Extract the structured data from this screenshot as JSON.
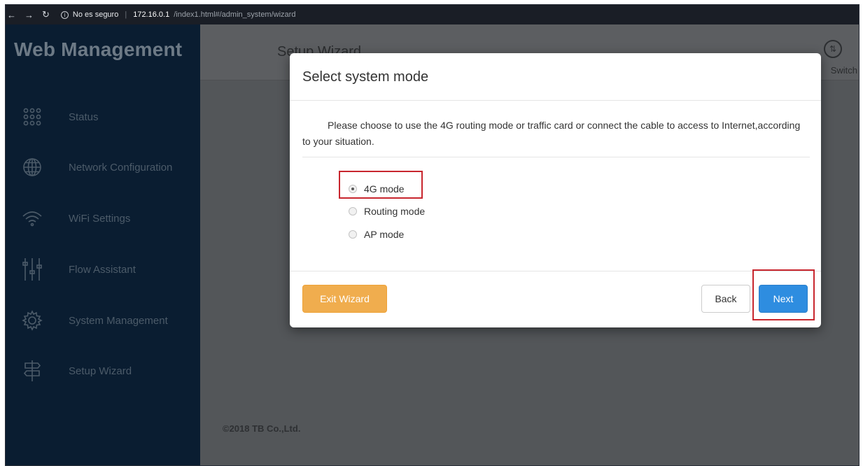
{
  "browser": {
    "security_label": "No es seguro",
    "url_host": "172.16.0.1",
    "url_path": "/index1.html#/admin_system/wizard"
  },
  "app": {
    "brand": "Web Management",
    "page_title": "Setup Wizard",
    "switch_label": "Switch",
    "footer": "©2018 TB Co.,Ltd."
  },
  "sidebar": {
    "items": [
      {
        "label": "Status",
        "icon": "grid-dots-icon"
      },
      {
        "label": "Network Configuration",
        "icon": "globe-icon"
      },
      {
        "label": "WiFi Settings",
        "icon": "wifi-icon"
      },
      {
        "label": "Flow Assistant",
        "icon": "sliders-icon"
      },
      {
        "label": "System Management",
        "icon": "gear-icon"
      },
      {
        "label": "Setup Wizard",
        "icon": "signpost-icon"
      }
    ]
  },
  "modal": {
    "title": "Select system mode",
    "description": "Please choose to use the 4G routing mode or traffic card or connect the cable to access to Internet,according to your situation.",
    "options": [
      {
        "label": "4G mode",
        "selected": true
      },
      {
        "label": "Routing mode",
        "selected": false
      },
      {
        "label": "AP mode",
        "selected": false
      }
    ],
    "exit_label": "Exit Wizard",
    "back_label": "Back",
    "next_label": "Next"
  },
  "colors": {
    "sidebar_bg": "#0a1d31",
    "overlay_bg": "#535659",
    "exit_button": "#f0ad4e",
    "next_button": "#2e8de0",
    "highlight": "#c8262e"
  }
}
